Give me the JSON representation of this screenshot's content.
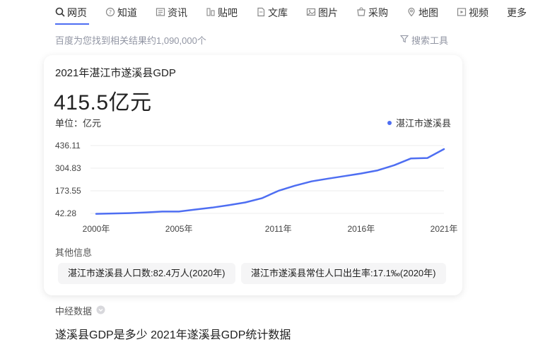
{
  "nav": {
    "items": [
      {
        "label": "网页",
        "icon": "search-icon"
      },
      {
        "label": "知道",
        "icon": "question-icon"
      },
      {
        "label": "资讯",
        "icon": "news-icon"
      },
      {
        "label": "贴吧",
        "icon": "tieba-icon"
      },
      {
        "label": "文库",
        "icon": "document-icon"
      },
      {
        "label": "图片",
        "icon": "image-icon"
      },
      {
        "label": "采购",
        "icon": "cart-icon"
      },
      {
        "label": "地图",
        "icon": "map-icon"
      },
      {
        "label": "视频",
        "icon": "video-icon"
      },
      {
        "label": "更多"
      }
    ]
  },
  "results": {
    "count_text": "百度为您找到相关结果约1,090,000个",
    "search_tools_label": "搜索工具"
  },
  "card": {
    "title": "2021年湛江市遂溪县GDP",
    "value": "415.5亿元",
    "unit": "单位：亿元",
    "legend": "湛江市遂溪县",
    "other_info_label": "其他信息",
    "pills": [
      "湛江市遂溪县人口数:82.4万人(2020年)",
      "湛江市遂溪县常住人口出生率:17.1‰(2020年)"
    ]
  },
  "chart_data": {
    "type": "line",
    "x": [
      2000,
      2001,
      2002,
      2003,
      2004,
      2005,
      2006,
      2007,
      2008,
      2009,
      2010,
      2011,
      2012,
      2013,
      2014,
      2015,
      2016,
      2017,
      2018,
      2019,
      2020,
      2021
    ],
    "series": [
      {
        "name": "湛江市遂溪县",
        "values": [
          40,
          42,
          44,
          48,
          53,
          53,
          65,
          76,
          90,
          106,
          130,
          173,
          203,
          228,
          244,
          259,
          274,
          292,
          322,
          361,
          364,
          415.5
        ]
      }
    ],
    "y_ticks": [
      "436.11",
      "304.83",
      "173.55",
      "42.28"
    ],
    "x_ticks": [
      "2000年",
      "2005年",
      "2011年",
      "2016年",
      "2021年"
    ],
    "ylim": [
      42.28,
      436.11
    ],
    "grid": true,
    "line_color": "#4e6ef2"
  },
  "source": {
    "label": "中经数据"
  },
  "bottom_text": "遂溪县GDP是多少 2021年遂溪县GDP统计数据"
}
